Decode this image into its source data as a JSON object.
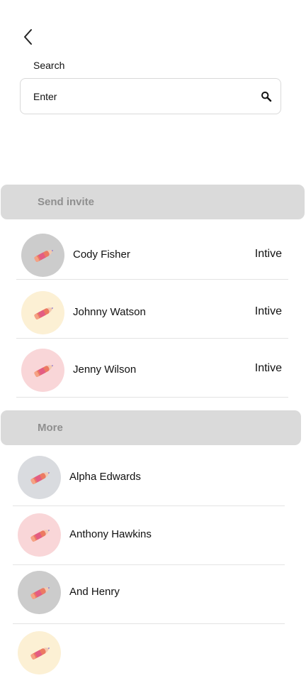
{
  "search": {
    "label": "Search",
    "placeholder": "Enter"
  },
  "sections": {
    "invite": {
      "title": "Send invite"
    },
    "more": {
      "title": "More"
    }
  },
  "invite_list": [
    {
      "name": "Cody Fisher",
      "action": "Intive",
      "avatar_color": "#cccccc"
    },
    {
      "name": "Johnny Watson",
      "action": "Intive",
      "avatar_color": "#fcf0d4"
    },
    {
      "name": "Jenny Wilson",
      "action": "Intive",
      "avatar_color": "#f9d6d8"
    }
  ],
  "more_list": [
    {
      "name": "Alpha Edwards",
      "avatar_color": "#d9dbdf"
    },
    {
      "name": "Anthony Hawkins",
      "avatar_color": "#f9d6d8"
    },
    {
      "name": "And Henry",
      "avatar_color": "#cccccc"
    },
    {
      "avatar_color": "#fcf0d4"
    }
  ],
  "icons": {
    "back": "back-arrow-icon",
    "search": "search-icon",
    "avatar": "pencil-avatar-icon"
  }
}
